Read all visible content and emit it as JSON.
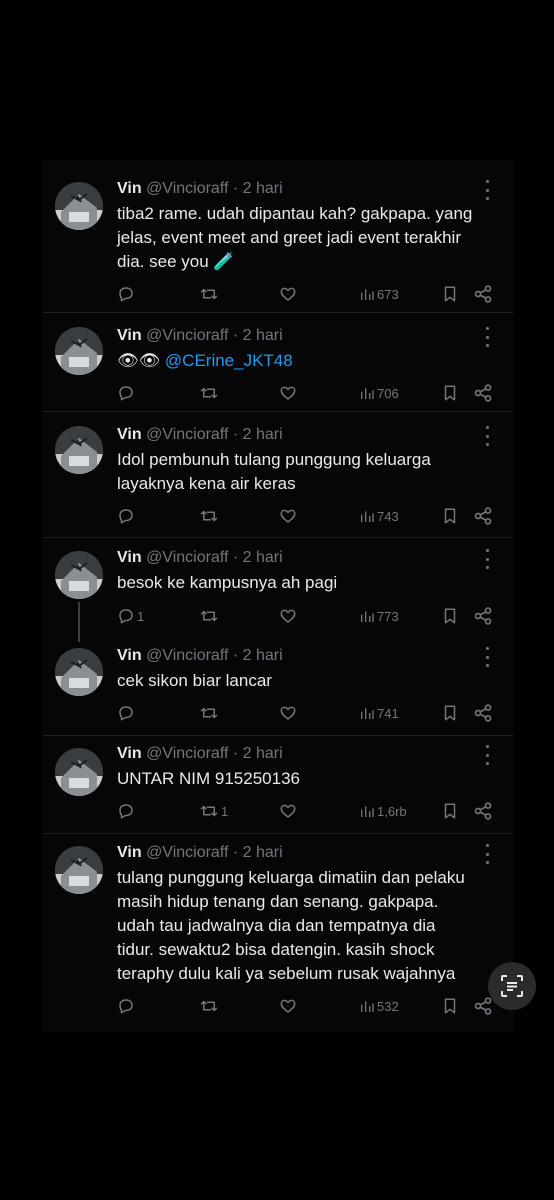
{
  "tweets": [
    {
      "name": "Vin",
      "handle": "@Vincioraff",
      "dot": "·",
      "time": "2 hari",
      "lines": [
        "tiba2 rame. udah dipantau kah? gakpapa. yang",
        "jelas, event meet and greet jadi event terakhir",
        "dia. see you 🧪"
      ],
      "replies": "",
      "retweets": "",
      "views": "673"
    },
    {
      "name": "Vin",
      "handle": "@Vincioraff",
      "dot": "·",
      "time": "2 hari",
      "emoji": "👁👁",
      "mention": "@CErine_JKT48",
      "replies": "",
      "retweets": "",
      "views": "706"
    },
    {
      "name": "Vin",
      "handle": "@Vincioraff",
      "dot": "·",
      "time": "2 hari",
      "lines": [
        "Idol pembunuh tulang punggung keluarga",
        "layaknya kena air keras"
      ],
      "replies": "",
      "retweets": "",
      "views": "743"
    },
    {
      "name": "Vin",
      "handle": "@Vincioraff",
      "dot": "·",
      "time": "2 hari",
      "lines": [
        "besok ke kampusnya ah pagi"
      ],
      "replies": "1",
      "retweets": "",
      "views": "773"
    },
    {
      "name": "Vin",
      "handle": "@Vincioraff",
      "dot": "·",
      "time": "2 hari",
      "lines": [
        "cek sikon biar lancar"
      ],
      "replies": "",
      "retweets": "",
      "views": "741"
    },
    {
      "name": "Vin",
      "handle": "@Vincioraff",
      "dot": "·",
      "time": "2 hari",
      "lines": [
        "UNTAR NIM 915250136"
      ],
      "replies": "",
      "retweets": "1",
      "views": "1,6rb"
    },
    {
      "name": "Vin",
      "handle": "@Vincioraff",
      "dot": "·",
      "time": "2 hari",
      "lines": [
        "tulang punggung keluarga dimatiin dan pelaku",
        "masih hidup tenang dan senang. gakpapa.",
        "udah tau jadwalnya dia dan tempatnya dia",
        "tidur. sewaktu2 bisa datengin. kasih shock",
        "teraphy dulu kali ya sebelum rusak wajahnya"
      ],
      "replies": "",
      "retweets": "",
      "views": "532"
    }
  ],
  "icons": {
    "reply": "reply-icon",
    "retweet": "retweet-icon",
    "like": "heart-icon",
    "views": "views-icon",
    "bookmark": "bookmark-icon",
    "share": "share-icon",
    "more": "more-icon",
    "lens": "google-lens-icon"
  },
  "colors": {
    "background": "#000000",
    "text": "#e7e9ea",
    "muted": "#71767b",
    "link": "#1d9bf0"
  }
}
